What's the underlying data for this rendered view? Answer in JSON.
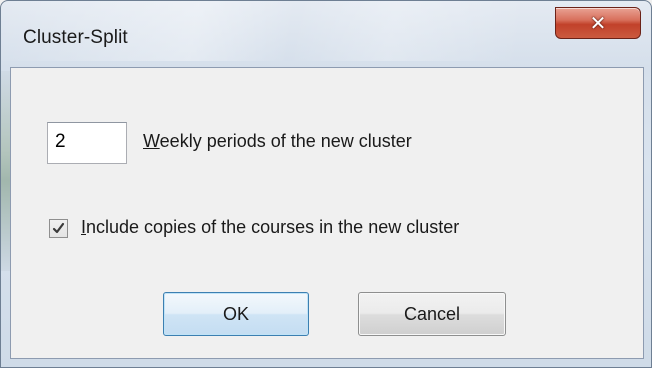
{
  "window": {
    "title": "Cluster-Split"
  },
  "periods": {
    "value": "2",
    "label_mnemonic": "W",
    "label_rest": "eekly periods of the new cluster"
  },
  "include_copies": {
    "checked": true,
    "label_mnemonic": "I",
    "label_rest": "nclude copies of the courses in the new cluster"
  },
  "buttons": {
    "ok": "OK",
    "cancel": "Cancel"
  },
  "icons": {
    "close": "close-icon",
    "check": "checkmark-icon"
  }
}
